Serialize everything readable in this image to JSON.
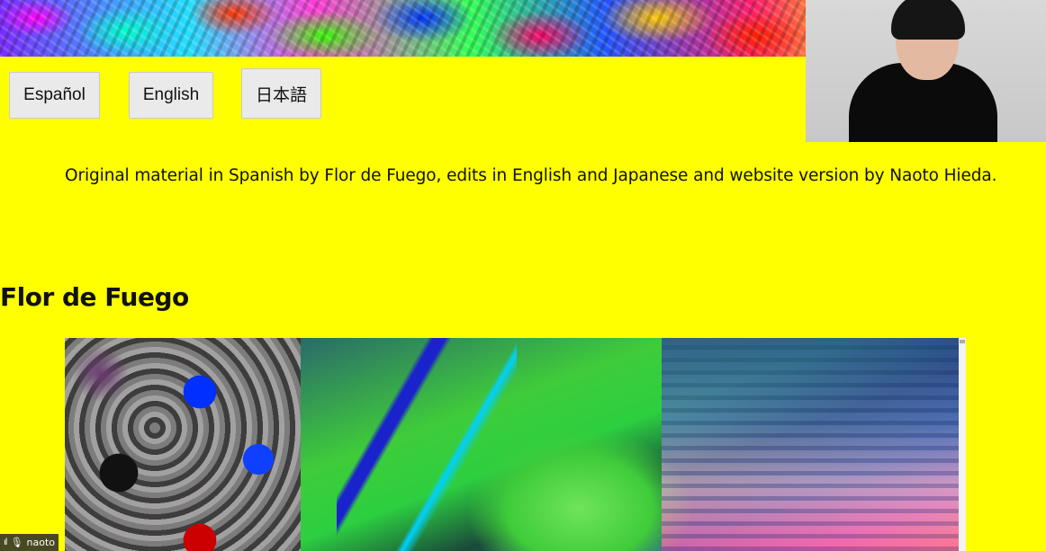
{
  "languages": [
    {
      "label": "Español"
    },
    {
      "label": "English"
    },
    {
      "label": "日本語"
    }
  ],
  "credits": "Original material in Spanish by Flor de Fuego, edits in English and Japanese and website version by Naoto Hieda.",
  "heading": "Flor de Fuego",
  "participant": {
    "name": "naoto",
    "signal_icon": "signal-bars-icon",
    "mic_icon": "microphone-icon"
  },
  "colors": {
    "background": "#ffff00",
    "button_bg": "#eaeaea"
  }
}
